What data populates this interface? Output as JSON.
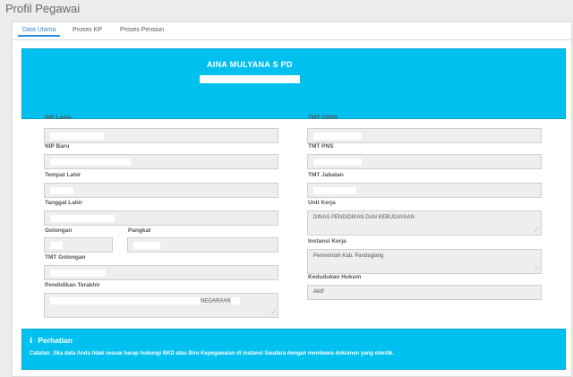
{
  "page": {
    "title": "Profil Pegawai"
  },
  "tabs": [
    {
      "label": "Data Utama",
      "active": true
    },
    {
      "label": "Proses KP",
      "active": false
    },
    {
      "label": "Proses Pensiun",
      "active": false
    }
  ],
  "header": {
    "name": "AINA MULYANA S PD"
  },
  "left_fields": {
    "nip_lama": {
      "label": "NIP Lama",
      "value": ""
    },
    "nip_baru": {
      "label": "NIP Baru",
      "value": ""
    },
    "tempat_lahir": {
      "label": "Tempat Lahir",
      "value": ""
    },
    "tanggal_lahir": {
      "label": "Tanggal Lahir",
      "value": ""
    },
    "golongan": {
      "label": "Golongan",
      "value": ""
    },
    "pangkat": {
      "label": "Pangkat",
      "value": ""
    },
    "tmt_golongan": {
      "label": "TMT Golongan",
      "value": ""
    },
    "pendidikan_terakhir": {
      "label": "Pendidikan Terakhir",
      "value": "",
      "visible_suffix": "NEGARAAN"
    }
  },
  "right_fields": {
    "tmt_cpns": {
      "label": "TMT CPNS",
      "value": ""
    },
    "tmt_pns": {
      "label": "TMT PNS",
      "value": ""
    },
    "tmt_jabatan": {
      "label": "TMT Jabatan",
      "value": ""
    },
    "unit_kerja": {
      "label": "Unit Kerja",
      "value": "DINAS PENDIDIKAN DAN KEBUDAYAAN"
    },
    "instansi_kerja": {
      "label": "Instansi Kerja",
      "value": "Pemerintah Kab. Pandeglang"
    },
    "kedudukan_hukum": {
      "label": "Kedudukan Hukum",
      "value": "Aktif"
    }
  },
  "alert": {
    "icon": "info-icon",
    "title": "Perhatian",
    "text": "Catatan: Jika data Anda tidak sesuai harap hubungi BKD atau Biro Kepegawaian di instansi Saudara dengan membawa dokumen yang otentik."
  },
  "colors": {
    "info": "#00c0ef",
    "tab_active": "#2a8bd8",
    "field_bg": "#eeeeee"
  }
}
